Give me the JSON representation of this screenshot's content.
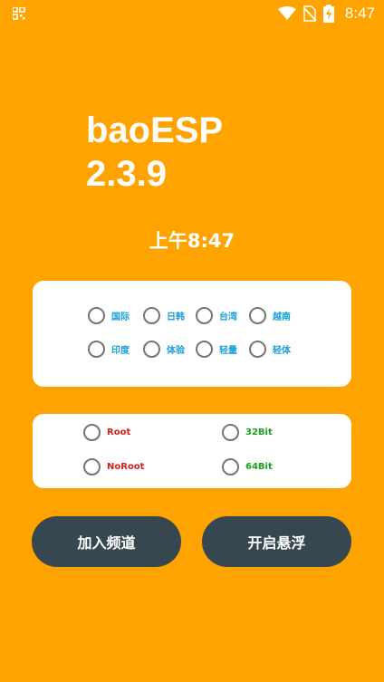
{
  "status_bar": {
    "time": "8:47",
    "icons": [
      "qr-scan-icon",
      "wifi-icon",
      "no-sim-icon",
      "battery-charging-icon"
    ]
  },
  "app": {
    "name": "baoESP",
    "version": "2.3.9"
  },
  "clock": {
    "text": "上午8:47"
  },
  "region_options": [
    {
      "label": "国际",
      "checked": false
    },
    {
      "label": "日韩",
      "checked": false
    },
    {
      "label": "台湾",
      "checked": false
    },
    {
      "label": "越南",
      "checked": false
    },
    {
      "label": "印度",
      "checked": false
    },
    {
      "label": "体验",
      "checked": false
    },
    {
      "label": "轻量",
      "checked": false
    },
    {
      "label": "轻体",
      "checked": false
    }
  ],
  "mode_options": [
    {
      "label": "Root",
      "checked": false
    },
    {
      "label": "NoRoot",
      "checked": false
    }
  ],
  "arch_options": [
    {
      "label": "32Bit",
      "checked": false
    },
    {
      "label": "64Bit",
      "checked": false
    }
  ],
  "buttons": {
    "join_channel": "加入频道",
    "open_float": "开启悬浮"
  },
  "colors": {
    "background": "#FFA300",
    "card": "#FFFFFF",
    "button": "#37474F",
    "label_blue": "#1B9FD8",
    "label_red": "#D21F1F",
    "label_green": "#19A219",
    "radio_ring": "#757575"
  }
}
